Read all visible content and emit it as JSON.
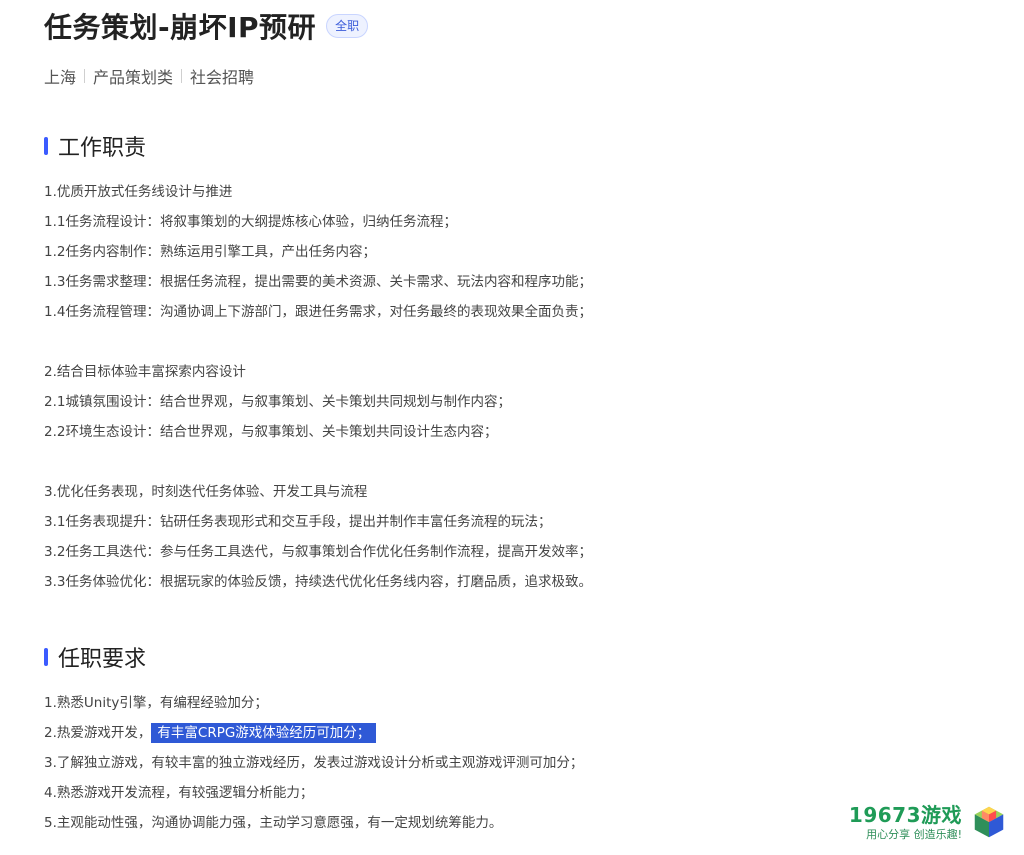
{
  "header": {
    "title": "任务策划-崩坏IP预研",
    "tag": "全职",
    "meta": [
      "上海",
      "产品策划类",
      "社会招聘"
    ]
  },
  "sections": {
    "responsibilities": {
      "title": "工作职责",
      "lines": [
        "1.优质开放式任务线设计与推进",
        "1.1任务流程设计：将叙事策划的大纲提炼核心体验，归纳任务流程；",
        "1.2任务内容制作：熟练运用引擎工具，产出任务内容；",
        "1.3任务需求整理：根据任务流程，提出需要的美术资源、关卡需求、玩法内容和程序功能；",
        "1.4任务流程管理：沟通协调上下游部门，跟进任务需求，对任务最终的表现效果全面负责；",
        "",
        "2.结合目标体验丰富探索内容设计",
        "2.1城镇氛围设计：结合世界观，与叙事策划、关卡策划共同规划与制作内容；",
        "2.2环境生态设计：结合世界观，与叙事策划、关卡策划共同设计生态内容；",
        "",
        "3.优化任务表现，时刻迭代任务体验、开发工具与流程",
        "3.1任务表现提升：钻研任务表现形式和交互手段，提出并制作丰富任务流程的玩法；",
        "3.2任务工具迭代：参与任务工具迭代，与叙事策划合作优化任务制作流程，提高开发效率；",
        "3.3任务体验优化：根据玩家的体验反馈，持续迭代优化任务线内容，打磨品质，追求极致。"
      ]
    },
    "requirements": {
      "title": "任职要求",
      "lines": [
        "1.熟悉Unity引擎，有编程经验加分；",
        "2.热爱游戏开发，",
        "3.了解独立游戏，有较丰富的独立游戏经历，发表过游戏设计分析或主观游戏评测可加分；",
        "4.熟悉游戏开发流程，有较强逻辑分析能力；",
        "5.主观能动性强，沟通协调能力强，主动学习意愿强，有一定规划统筹能力。"
      ],
      "highlighted_text": "有丰富CRPG游戏体验经历可加分；"
    }
  },
  "watermark": {
    "main": "19673游戏",
    "sub": "用心分享 创造乐趣!",
    "colors": {
      "primary": "#1f9b57",
      "accent_blue": "#2f59d6"
    }
  },
  "theme": {
    "accent": "#3b5bff",
    "highlight_bg": "#2f59d6",
    "text_primary": "#222222",
    "text_body": "#444444"
  }
}
